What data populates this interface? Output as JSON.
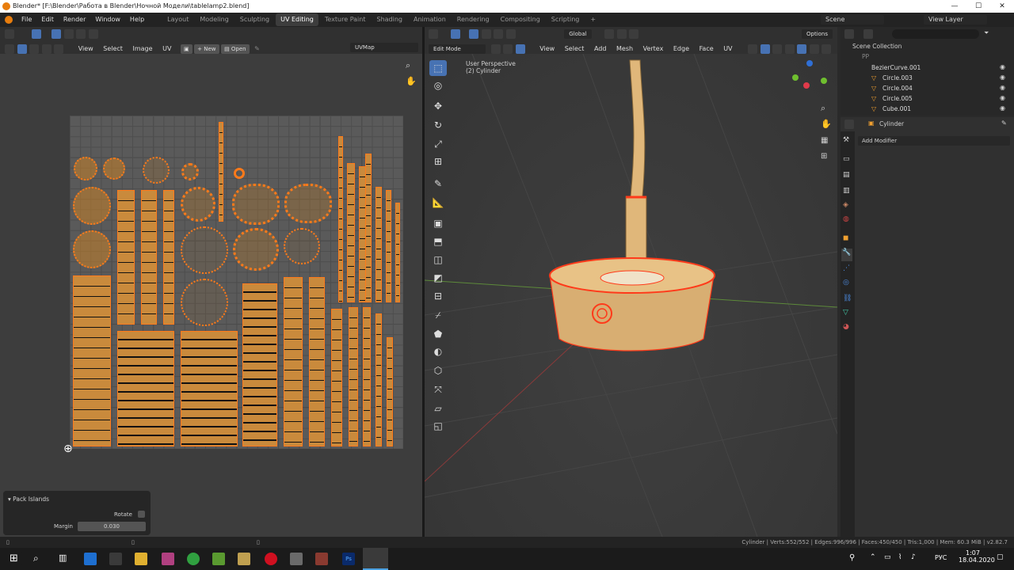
{
  "window": {
    "title": "Blender* [F:\\Blender\\Работа в Blender\\Ночной Модели\\tablelamp2.blend]"
  },
  "menus": [
    "File",
    "Edit",
    "Render",
    "Window",
    "Help"
  ],
  "workspaces": [
    "Layout",
    "Modeling",
    "Sculpting",
    "UV Editing",
    "Texture Paint",
    "Shading",
    "Animation",
    "Rendering",
    "Compositing",
    "Scripting"
  ],
  "active_workspace": "UV Editing",
  "scene": {
    "name": "Scene",
    "view_layer": "View Layer"
  },
  "uv_editor": {
    "menus": [
      "View",
      "Select",
      "Image",
      "UV"
    ],
    "new_label": "New",
    "open_label": "Open",
    "uvmap": "UVMap"
  },
  "pack_islands": {
    "title": "Pack Islands",
    "rotate_label": "Rotate",
    "margin_label": "Margin",
    "margin_value": "0.030"
  },
  "viewport": {
    "mode": "Edit Mode",
    "menus": [
      "View",
      "Select",
      "Add",
      "Mesh",
      "Vertex",
      "Edge",
      "Face",
      "UV"
    ],
    "orientation": "Global",
    "options": "Options",
    "overlay_line1": "User Perspective",
    "overlay_line2": "(2) Cylinder"
  },
  "outliner": {
    "root": "Scene Collection",
    "collection": "PP",
    "items": [
      "BezierCurve.001",
      "Circle.003",
      "Circle.004",
      "Circle.005",
      "Cube.001"
    ]
  },
  "properties": {
    "object": "Cylinder",
    "add_modifier": "Add Modifier"
  },
  "status": {
    "text": "Cylinder | Verts:552/552 | Edges:996/996 | Faces:450/450 | Tris:1,000 | Mem: 60.3 MiB | v2.82.7"
  },
  "taskbar": {
    "lang": "РУС",
    "time": "1:07",
    "date": "18.04.2020"
  },
  "colors": {
    "accent": "#4772b3",
    "uv_orange": "#ff7a1a",
    "wood": "#e0b77a"
  }
}
